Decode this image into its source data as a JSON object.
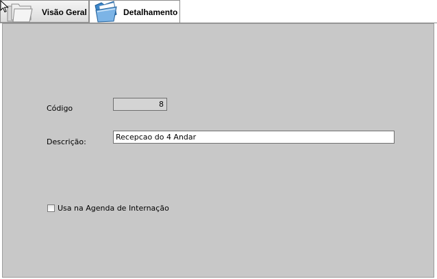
{
  "tabs": {
    "overview_label": "Visão Geral",
    "detail_label": "Detalhamento",
    "overview_icon": "folders-icon",
    "detail_icon": "open-folder-icon"
  },
  "form": {
    "codigo_label": "Código",
    "codigo_value": "8",
    "descricao_label": "Descrição:",
    "descricao_value": "Recepcao do 4 Andar",
    "checkbox_label": "Usa na Agenda de Internação",
    "checkbox_checked": false
  },
  "colors": {
    "panel_background": "#c8c8c8",
    "field_background": "#ffffff",
    "readonly_field_background": "#d4d4d4"
  }
}
